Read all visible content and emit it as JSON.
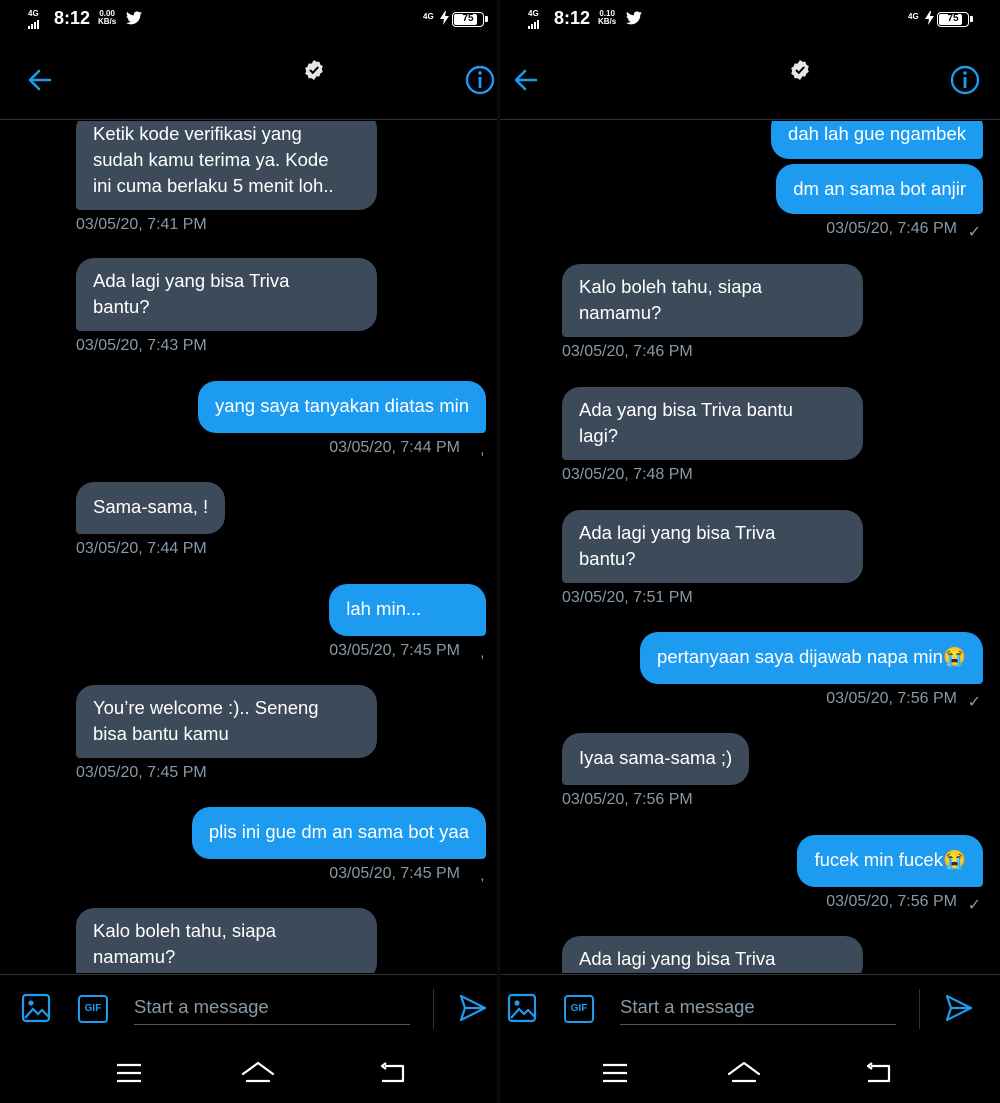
{
  "screens": [
    {
      "status": {
        "signal": "4G",
        "time": "8:12",
        "speed_value": "0.00",
        "speed_unit": "KB/s",
        "network": "4G",
        "battery": "75"
      },
      "composer": {
        "placeholder": "Start a message",
        "gif_label": "GIF"
      },
      "messages": [
        {
          "dir": "in",
          "text": "Ketik kode verifikasi yang\nsudah kamu terima ya. Kode\nini cuma berlaku 5 menit loh..",
          "time": "03/05/20, 7:41 PM"
        },
        {
          "dir": "in",
          "text": "Ada lagi yang bisa Triva\nbantu?",
          "time": "03/05/20, 7:43 PM"
        },
        {
          "dir": "out",
          "text": "yang saya tanyakan diatas min",
          "time": "03/05/20, 7:44 PM"
        },
        {
          "dir": "in",
          "text": "Sama-sama, !",
          "time": "03/05/20, 7:44 PM"
        },
        {
          "dir": "out",
          "text": "lah min...",
          "time": "03/05/20, 7:45 PM"
        },
        {
          "dir": "in",
          "text": "You’re welcome :)..  Seneng\nbisa bantu kamu",
          "time": "03/05/20, 7:45 PM"
        },
        {
          "dir": "out",
          "text": "plis ini gue dm an sama bot yaa",
          "time": "03/05/20, 7:45 PM"
        },
        {
          "dir": "in",
          "text": "Kalo boleh tahu, siapa\nnamamu?",
          "time": ""
        }
      ]
    },
    {
      "status": {
        "signal": "4G",
        "time": "8:12",
        "speed_value": "0.10",
        "speed_unit": "KB/s",
        "network": "4G",
        "battery": "75"
      },
      "composer": {
        "placeholder": "Start a message",
        "gif_label": "GIF"
      },
      "messages": [
        {
          "dir": "out",
          "text": "dah lah gue ngambek",
          "time": ""
        },
        {
          "dir": "out",
          "text": "dm an sama bot anjir",
          "time": "03/05/20, 7:46 PM"
        },
        {
          "dir": "in",
          "text": "Kalo boleh tahu, siapa\nnamamu?",
          "time": "03/05/20, 7:46 PM"
        },
        {
          "dir": "in",
          "text": "Ada yang bisa Triva bantu\nlagi?",
          "time": "03/05/20, 7:48 PM"
        },
        {
          "dir": "in",
          "text": "Ada lagi yang bisa Triva\nbantu?",
          "time": "03/05/20, 7:51 PM"
        },
        {
          "dir": "out",
          "text": "pertanyaan saya dijawab napa min😭",
          "time": "03/05/20, 7:56 PM"
        },
        {
          "dir": "in",
          "text": "Iyaa sama-sama ;)",
          "time": "03/05/20, 7:56 PM"
        },
        {
          "dir": "out",
          "text": "fucek min fucek😭",
          "time": "03/05/20, 7:56 PM"
        },
        {
          "dir": "in",
          "text": "Ada lagi yang bisa Triva",
          "time": ""
        }
      ]
    }
  ],
  "icons": {
    "back": "arrow-left-icon",
    "verified": "verified-badge-icon",
    "info": "info-icon",
    "image": "image-icon",
    "gif": "gif-icon",
    "send": "send-icon",
    "nav_menu": "menu-icon",
    "nav_home": "home-icon",
    "nav_back": "back-icon"
  },
  "colors": {
    "accent": "#1d9bf0",
    "incoming_bubble": "#3d4a59",
    "timestamp": "#8899a6",
    "background": "#000000"
  }
}
